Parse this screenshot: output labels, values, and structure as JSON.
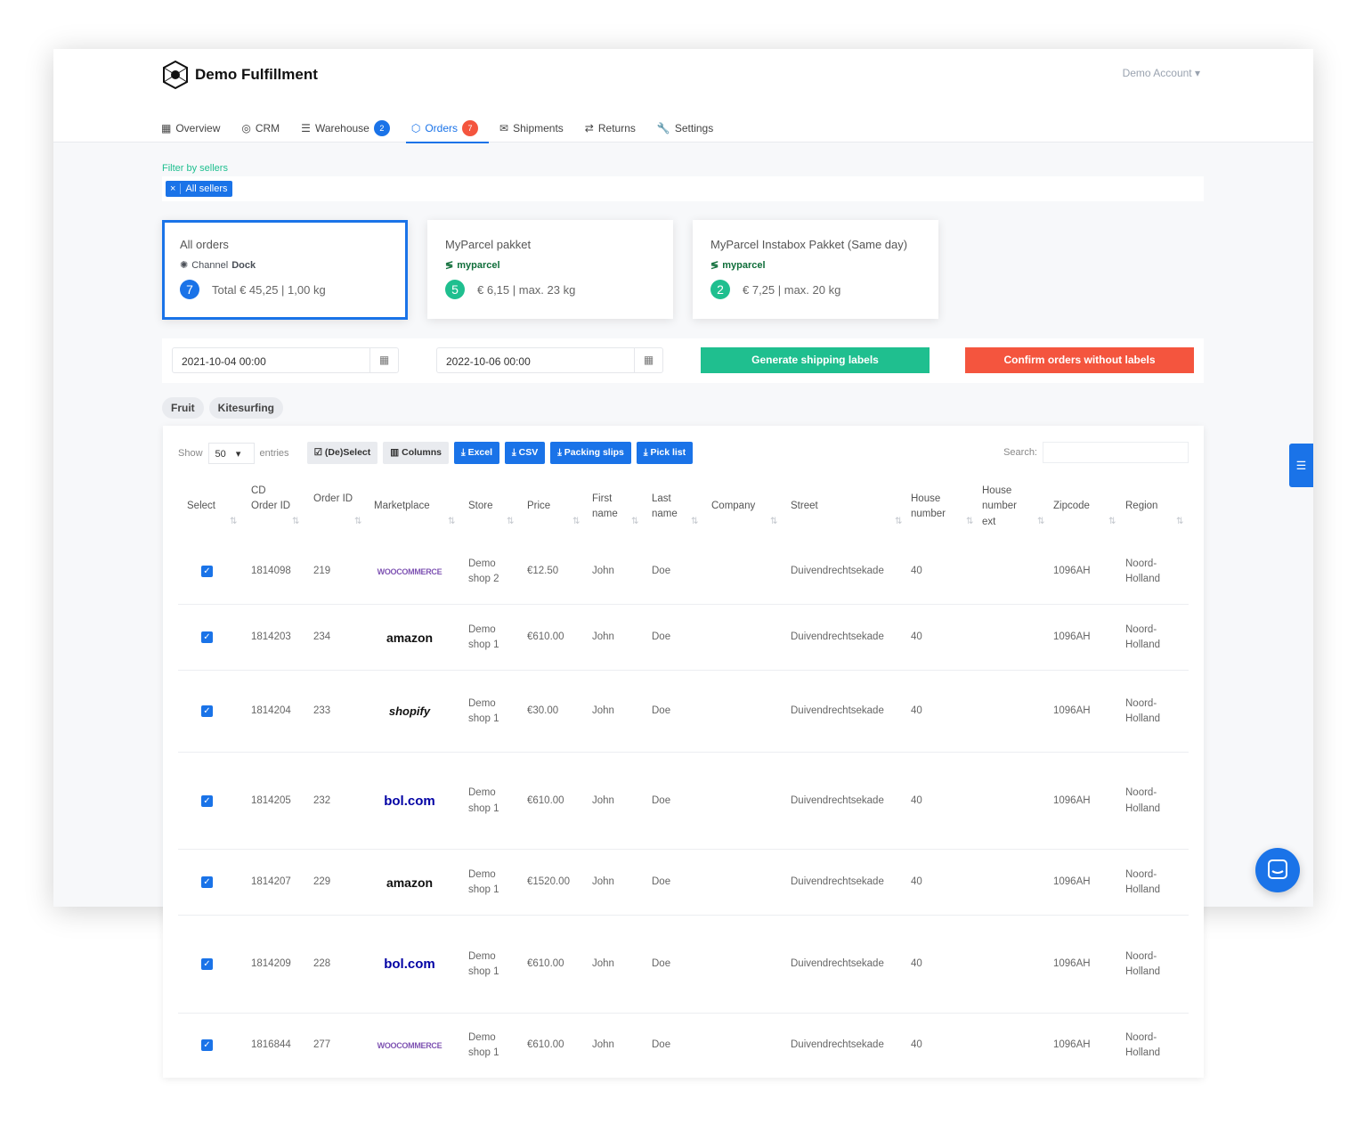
{
  "app": {
    "title": "Demo Fulfillment",
    "account": "Demo Account"
  },
  "nav": [
    {
      "label": "Overview",
      "icon": "grid-icon"
    },
    {
      "label": "CRM",
      "icon": "user-circle-icon"
    },
    {
      "label": "Warehouse",
      "icon": "list-icon",
      "badge": "2"
    },
    {
      "label": "Orders",
      "icon": "box-icon",
      "badge": "7",
      "active": true
    },
    {
      "label": "Shipments",
      "icon": "envelope-icon"
    },
    {
      "label": "Returns",
      "icon": "exchange-icon"
    },
    {
      "label": "Settings",
      "icon": "wrench-icon"
    }
  ],
  "filter": {
    "label": "Filter by sellers",
    "chip_remove": "×",
    "chip": "All sellers"
  },
  "cards": [
    {
      "title": "All orders",
      "brand_a": "Channel",
      "brand_b": "Dock",
      "count": "7",
      "info": "Total € 45,25 | 1,00 kg",
      "color": "#1a73e8"
    },
    {
      "title": "MyParcel pakket",
      "brand": "myparcel",
      "count": "5",
      "info": "€ 6,15 | max. 23 kg",
      "color": "#1fbf8f"
    },
    {
      "title": "MyParcel Instabox Pakket (Same day)",
      "brand": "myparcel",
      "count": "2",
      "info": "€ 7,25 | max. 20 kg",
      "color": "#1fbf8f"
    }
  ],
  "dates": {
    "from": "2021-10-04 00:00",
    "to": "2022-10-06 00:00"
  },
  "actions": {
    "generate": "Generate shipping labels",
    "confirm": "Confirm orders without labels",
    "generate_color": "#1fbf8f",
    "confirm_color": "#f4553e"
  },
  "tags": [
    "Fruit",
    "Kitesurfing"
  ],
  "table": {
    "show": "Show",
    "entries_value": "50",
    "entries": "entries",
    "search_label": "Search:",
    "buttons": [
      "(De)Select",
      "Columns",
      "Excel",
      "CSV",
      "Packing slips",
      "Pick list"
    ],
    "headers": [
      "Select",
      "CD Order ID",
      "Order ID",
      "Marketplace",
      "Store",
      "Price",
      "First name",
      "Last name",
      "Company",
      "Street",
      "House number",
      "House number ext",
      "Zipcode",
      "Region"
    ],
    "rows": [
      {
        "cd": "1814098",
        "order": "219",
        "marketplace": "woocommerce",
        "store": "Demo shop 2",
        "price": "€12.50",
        "first": "John",
        "last": "Doe",
        "company": "",
        "street": "Duivendrechtsekade",
        "house": "40",
        "ext": "",
        "zip": "1096AH",
        "region": "Noord-Holland"
      },
      {
        "cd": "1814203",
        "order": "234",
        "marketplace": "amazon",
        "store": "Demo shop 1",
        "price": "€610.00",
        "first": "John",
        "last": "Doe",
        "company": "",
        "street": "Duivendrechtsekade",
        "house": "40",
        "ext": "",
        "zip": "1096AH",
        "region": "Noord-Holland"
      },
      {
        "cd": "1814204",
        "order": "233",
        "marketplace": "shopify",
        "store": "Demo shop 1",
        "price": "€30.00",
        "first": "John",
        "last": "Doe",
        "company": "",
        "street": "Duivendrechtsekade",
        "house": "40",
        "ext": "",
        "zip": "1096AH",
        "region": "Noord-Holland"
      },
      {
        "cd": "1814205",
        "order": "232",
        "marketplace": "bol.com",
        "store": "Demo shop 1",
        "price": "€610.00",
        "first": "John",
        "last": "Doe",
        "company": "",
        "street": "Duivendrechtsekade",
        "house": "40",
        "ext": "",
        "zip": "1096AH",
        "region": "Noord-Holland"
      },
      {
        "cd": "1814207",
        "order": "229",
        "marketplace": "amazon",
        "store": "Demo shop 1",
        "price": "€1520.00",
        "first": "John",
        "last": "Doe",
        "company": "",
        "street": "Duivendrechtsekade",
        "house": "40",
        "ext": "",
        "zip": "1096AH",
        "region": "Noord-Holland"
      },
      {
        "cd": "1814209",
        "order": "228",
        "marketplace": "bol.com",
        "store": "Demo shop 1",
        "price": "€610.00",
        "first": "John",
        "last": "Doe",
        "company": "",
        "street": "Duivendrechtsekade",
        "house": "40",
        "ext": "",
        "zip": "1096AH",
        "region": "Noord-Holland"
      },
      {
        "cd": "1816844",
        "order": "277",
        "marketplace": "woocommerce",
        "store": "Demo shop 1",
        "price": "€610.00",
        "first": "John",
        "last": "Doe",
        "company": "",
        "street": "Duivendrechtsekade",
        "house": "40",
        "ext": "",
        "zip": "1096AH",
        "region": "Noord-Holland"
      }
    ]
  }
}
